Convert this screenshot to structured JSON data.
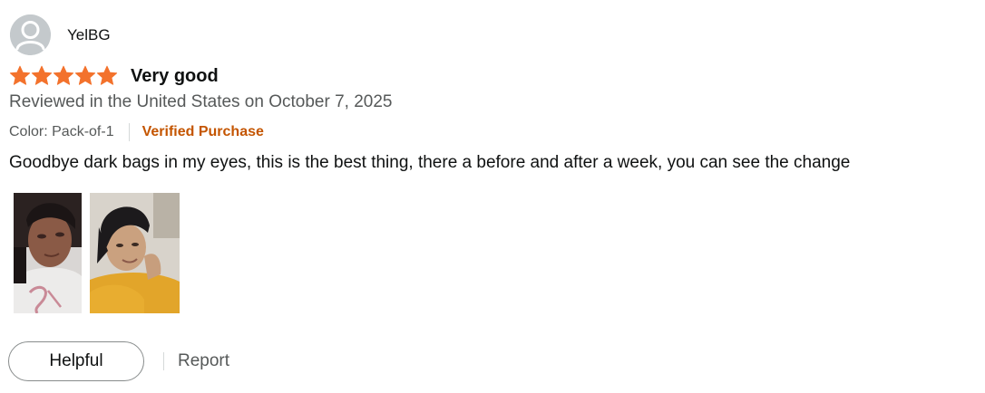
{
  "review": {
    "profile_name": "YelBG",
    "star_rating": 5,
    "star_max": 5,
    "title": "Very good",
    "date_line": "Reviewed in the United States on October 7, 2025",
    "variant": "Color: Pack-of-1",
    "verified_label": "Verified Purchase",
    "body": "Goodbye dark bags in my eyes, this is the best thing, there a before and after a week, you can see the change",
    "images": [
      {
        "icon": "review-photo-1"
      },
      {
        "icon": "review-photo-2"
      }
    ]
  },
  "actions": {
    "helpful_label": "Helpful",
    "report_label": "Report"
  },
  "colors": {
    "star": "#f3722c",
    "verified": "#c45500",
    "muted_text": "#565959",
    "primary_text": "#0f1111",
    "avatar_bg": "#c4c9cc"
  }
}
